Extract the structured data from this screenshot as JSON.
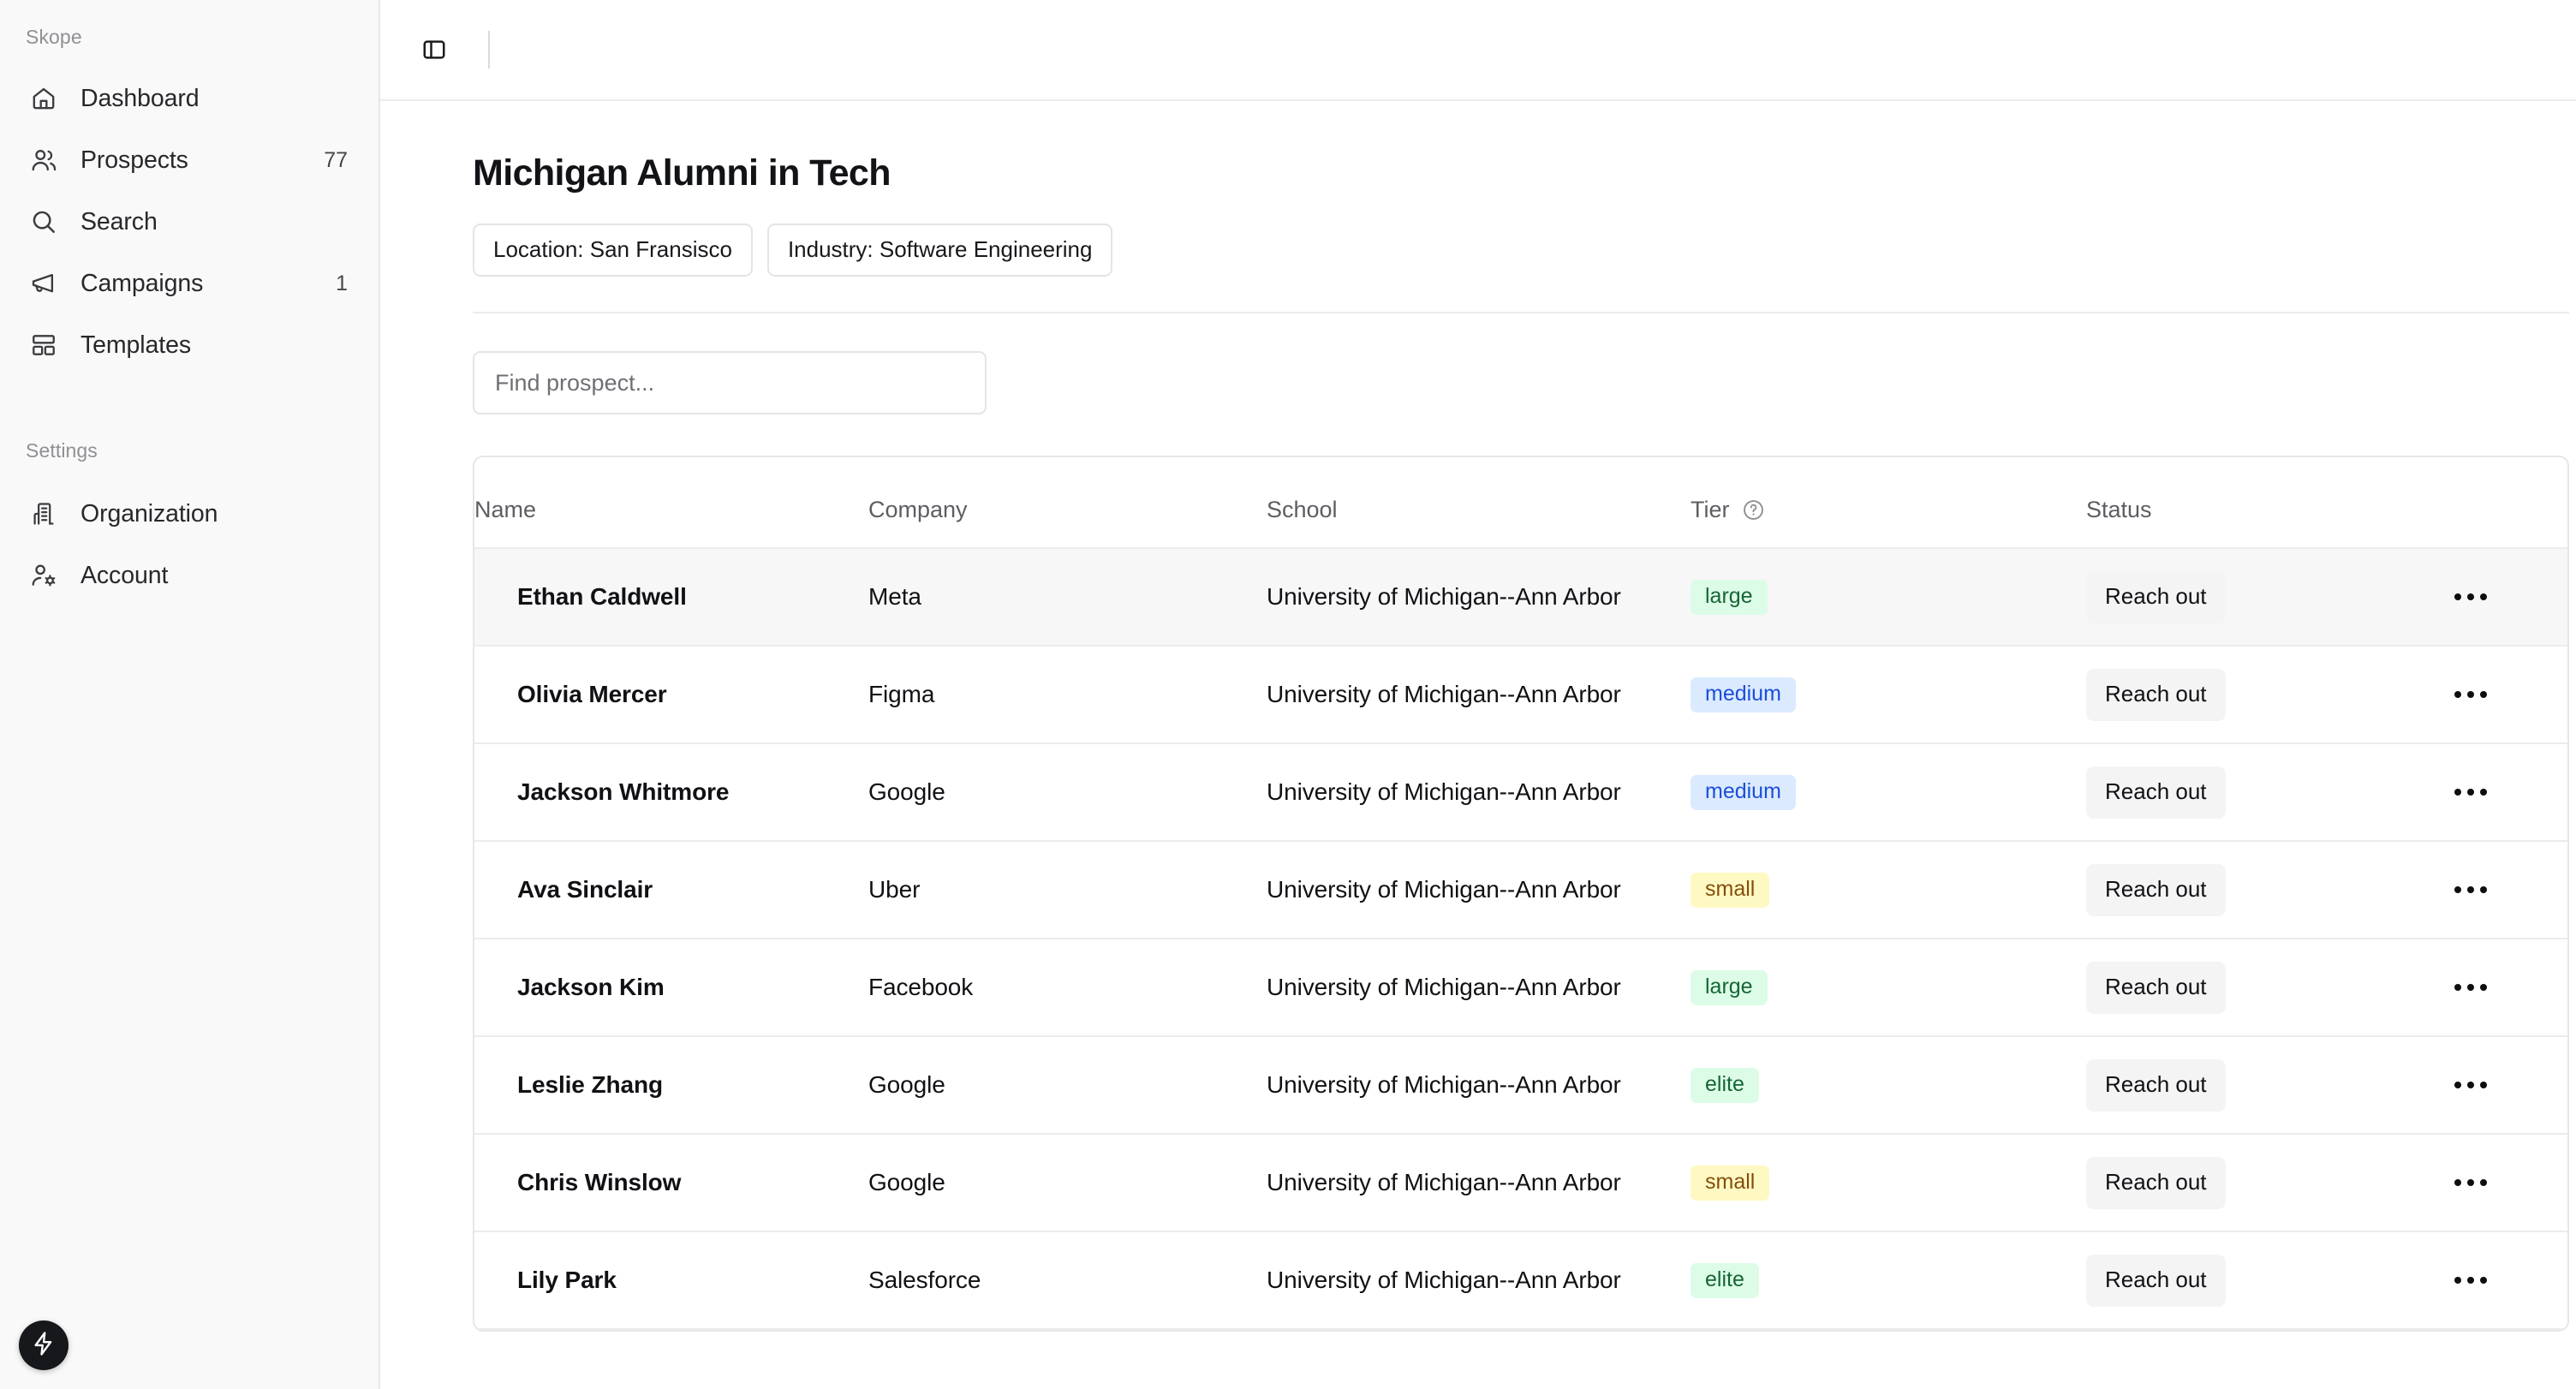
{
  "sidebar": {
    "brand": "Skope",
    "settings_label": "Settings",
    "items": [
      {
        "label": "Dashboard",
        "badge": "",
        "icon": "home-icon"
      },
      {
        "label": "Prospects",
        "badge": "77",
        "icon": "users-icon"
      },
      {
        "label": "Search",
        "badge": "",
        "icon": "search-icon"
      },
      {
        "label": "Campaigns",
        "badge": "1",
        "icon": "megaphone-icon"
      },
      {
        "label": "Templates",
        "badge": "",
        "icon": "layout-icon"
      }
    ],
    "settings_items": [
      {
        "label": "Organization",
        "badge": "",
        "icon": "building-icon"
      },
      {
        "label": "Account",
        "badge": "",
        "icon": "user-gear-icon"
      }
    ]
  },
  "topbar": {
    "toggle_icon": "sidebar-toggle-icon"
  },
  "page": {
    "title": "Michigan Alumni in Tech",
    "chips": [
      "Location: San Fransisco",
      "Industry: Software Engineering"
    ],
    "search_placeholder": "Find prospect...",
    "search_value": ""
  },
  "table": {
    "columns": [
      "Name",
      "Company",
      "School",
      "Tier",
      "Status"
    ],
    "tier_help_icon": "help-circle-icon",
    "row_action_label": "Reach out",
    "row_menu_icon": "ellipsis-icon",
    "rows": [
      {
        "name": "Ethan Caldwell",
        "company": "Meta",
        "school": "University of Michigan--Ann Arbor",
        "tier": "large",
        "status": "Reach out",
        "highlight": true
      },
      {
        "name": "Olivia Mercer",
        "company": "Figma",
        "school": "University of Michigan--Ann Arbor",
        "tier": "medium",
        "status": "Reach out",
        "highlight": false
      },
      {
        "name": "Jackson Whitmore",
        "company": "Google",
        "school": "University of Michigan--Ann Arbor",
        "tier": "medium",
        "status": "Reach out",
        "highlight": false
      },
      {
        "name": "Ava Sinclair",
        "company": "Uber",
        "school": "University of Michigan--Ann Arbor",
        "tier": "small",
        "status": "Reach out",
        "highlight": false
      },
      {
        "name": "Jackson Kim",
        "company": "Facebook",
        "school": "University of Michigan--Ann Arbor",
        "tier": "large",
        "status": "Reach out",
        "highlight": false
      },
      {
        "name": "Leslie Zhang",
        "company": "Google",
        "school": "University of Michigan--Ann Arbor",
        "tier": "elite",
        "status": "Reach out",
        "highlight": false
      },
      {
        "name": "Chris Winslow",
        "company": "Google",
        "school": "University of Michigan--Ann Arbor",
        "tier": "small",
        "status": "Reach out",
        "highlight": false
      },
      {
        "name": "Lily Park",
        "company": "Salesforce",
        "school": "University of Michigan--Ann Arbor",
        "tier": "elite",
        "status": "Reach out",
        "highlight": false
      }
    ]
  },
  "fab": {
    "icon": "lightning-bolt-icon"
  },
  "colors": {
    "tier_large_bg": "#dcfce7",
    "tier_large_fg": "#166534",
    "tier_medium_bg": "#dbeafe",
    "tier_medium_fg": "#1d4ed8",
    "tier_small_bg": "#fef9c3",
    "tier_small_fg": "#854d0e",
    "sidebar_bg": "#f9f9f9",
    "row_highlight_bg": "#f7f7f8"
  }
}
